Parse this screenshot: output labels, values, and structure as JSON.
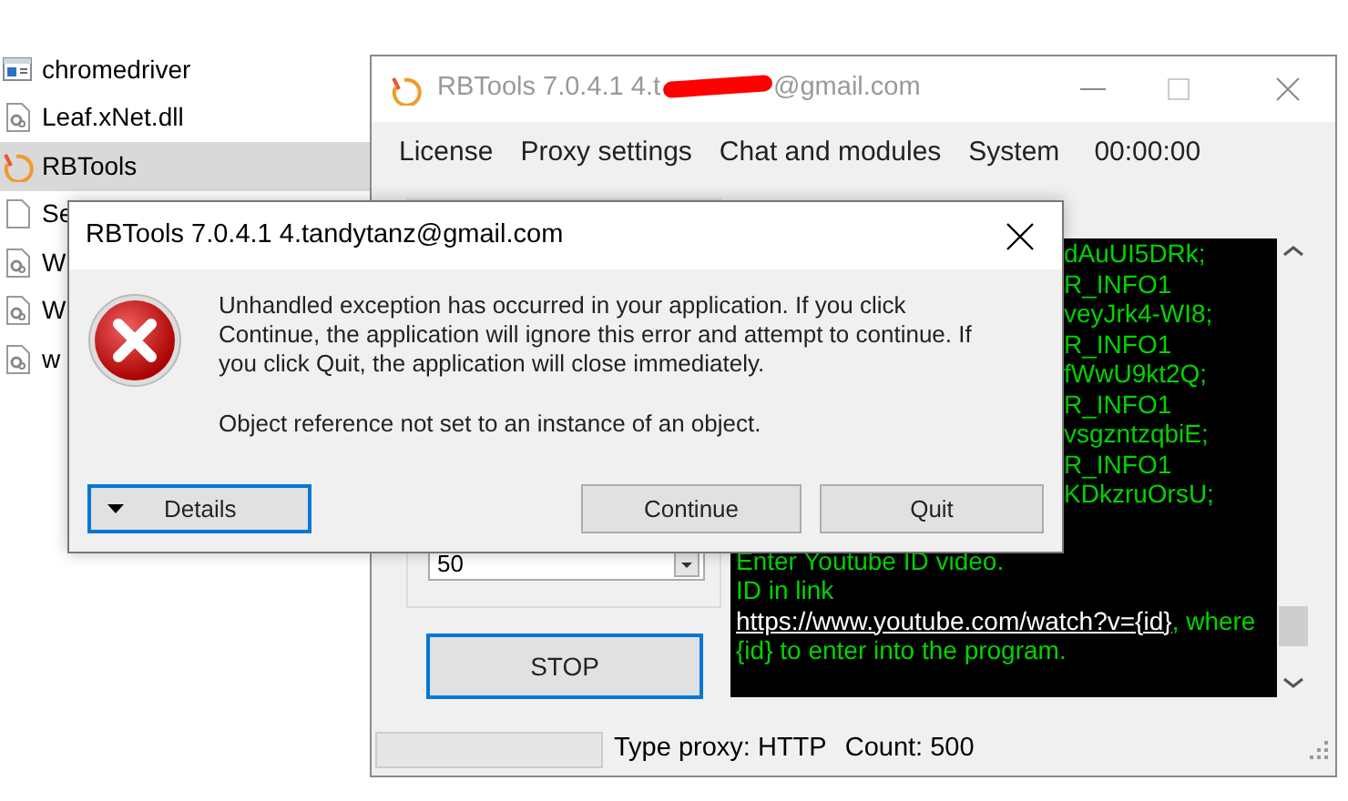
{
  "explorer": {
    "files": [
      {
        "name": "chromedriver",
        "kind": "app",
        "selected": false
      },
      {
        "name": "Leaf.xNet.dll",
        "kind": "dll",
        "selected": false
      },
      {
        "name": "RBTools",
        "kind": "rbtools",
        "selected": true
      },
      {
        "name": "Se",
        "kind": "blank",
        "selected": false
      },
      {
        "name": "W",
        "kind": "dll",
        "selected": false
      },
      {
        "name": "W",
        "kind": "dll",
        "selected": false
      },
      {
        "name": "w",
        "kind": "dll",
        "selected": false
      }
    ]
  },
  "main_window": {
    "title_start": "RBTools 7.0.4.1 4.t",
    "title_redacted": true,
    "title_end": "@gmail.com",
    "menu": [
      "License",
      "Proxy settings",
      "Chat and modules",
      "System"
    ],
    "timer": "00:00:00",
    "thread_count": "50",
    "stop_button": {
      "label": "STOP",
      "focused": true
    },
    "log": {
      "fragments": [
        "dAuUI5DRk;",
        "R_INFO1",
        "veyJrk4-WI8;",
        "R_INFO1",
        "fWwU9kt2Q;",
        "R_INFO1",
        "vsgzntzqbiE;",
        "R_INFO1",
        "KDkzruOrsU;"
      ],
      "lines": [
        "Enter Youtube ID video."
      ],
      "link_line": {
        "before": "ID in link ",
        "link": "https://www.youtube.com/watch?v={id}",
        "after": ", where {id} to enter into the program."
      }
    },
    "status_bar": {
      "type_proxy": "Type proxy: HTTP",
      "count": "Count: 500"
    }
  },
  "dialog": {
    "title": "RBTools 7.0.4.1 4.tandytanz@gmail.com",
    "message": "Unhandled exception has occurred in your application. If you click Continue, the application will ignore this error and attempt to continue. If you click Quit, the application will close immediately.",
    "detail": "Object reference not set to an instance of an object.",
    "buttons": [
      {
        "label": "Details",
        "kind": "details",
        "focused": true
      },
      {
        "label": "Continue",
        "kind": "plain",
        "focused": false
      },
      {
        "label": "Quit",
        "kind": "plain",
        "focused": false
      }
    ]
  }
}
